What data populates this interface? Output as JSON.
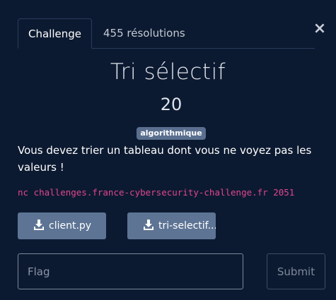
{
  "modal": {
    "close_label": "×",
    "tabs": [
      {
        "label": "Challenge",
        "active": true
      },
      {
        "label": "455 résolutions",
        "active": false
      }
    ],
    "title": "Tri sélectif",
    "points": "20",
    "tag": "algorithmique",
    "description": "Vous devez trier un tableau dont vous ne voyez pas les valeurs !",
    "command": "nc challenges.france-cybersecurity-challenge.fr 2051",
    "files": [
      {
        "label": "client.py",
        "icon": "download-icon"
      },
      {
        "label": "tri-selectif...",
        "icon": "download-icon"
      }
    ],
    "flag_placeholder": "Flag",
    "submit_label": "Submit"
  },
  "colors": {
    "background": "#0c1a31",
    "tag_bg": "#5a6f8f",
    "file_button_bg": "#5d7494",
    "command_text": "#e0468e",
    "tab_border": "#2a3d5c"
  }
}
